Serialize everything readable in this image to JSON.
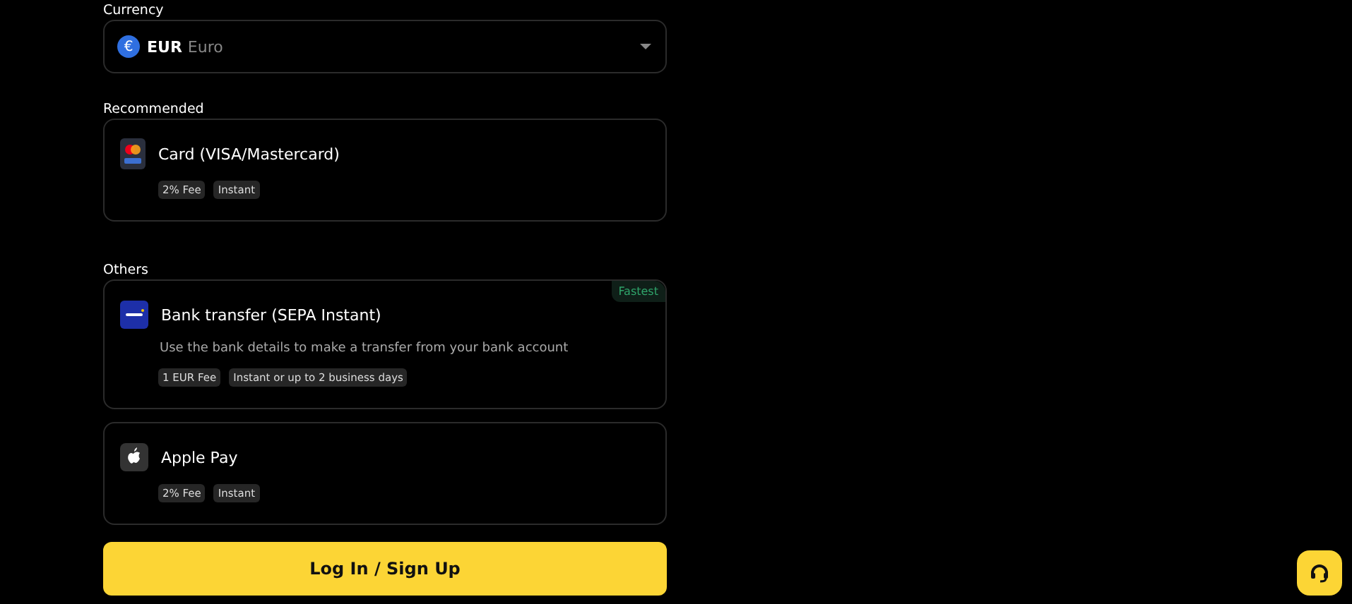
{
  "currency": {
    "label": "Currency",
    "code": "EUR",
    "name": "Euro",
    "symbol": "€"
  },
  "sections": [
    {
      "title": "Recommended",
      "methods": [
        {
          "kind": "card",
          "name": "Card (VISA/Mastercard)",
          "tags": [
            "2% Fee",
            "Instant"
          ]
        }
      ]
    },
    {
      "title": "Others",
      "methods": [
        {
          "kind": "sepa",
          "name": "Bank transfer (SEPA Instant)",
          "badge": "Fastest",
          "description": "Use the bank details to make a transfer from your bank account",
          "tags": [
            "1 EUR Fee",
            "Instant or up to 2 business days"
          ]
        },
        {
          "kind": "apple",
          "name": "Apple Pay",
          "tags": [
            "2% Fee",
            "Instant"
          ]
        }
      ]
    }
  ],
  "primary_button": "Log In / Sign Up"
}
